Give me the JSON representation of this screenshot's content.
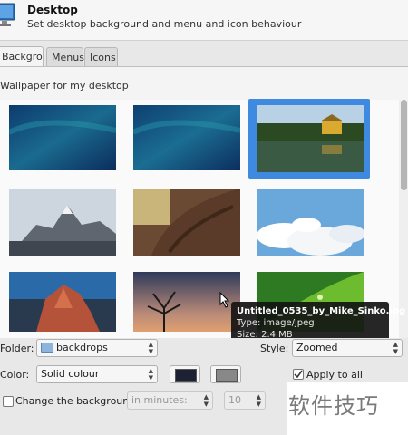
{
  "header": {
    "title": "Desktop",
    "subtitle": "Set desktop background and menu and icon behaviour",
    "icon": "monitor-icon"
  },
  "tabs": [
    {
      "label": "Background",
      "active": true
    },
    {
      "label": "Menus",
      "active": false
    },
    {
      "label": "Icons",
      "active": false
    }
  ],
  "wallpaper_section": {
    "label": "Wallpaper for my desktop",
    "thumbnails": [
      {
        "name": "blue-gradient-1",
        "selected": false
      },
      {
        "name": "blue-gradient-2",
        "selected": false
      },
      {
        "name": "Untitled_0535_by_Mike_Sinko.jpg",
        "selected": true
      },
      {
        "name": "mountain-peak",
        "selected": false
      },
      {
        "name": "tree-bark",
        "selected": false
      },
      {
        "name": "clouds-sky",
        "selected": false
      },
      {
        "name": "red-rocks-sunset",
        "selected": false
      },
      {
        "name": "tree-silhouette-dusk",
        "selected": false
      },
      {
        "name": "green-leaf-drops",
        "selected": false
      }
    ]
  },
  "tooltip": {
    "name": "Untitled_0535_by_Mike_Sinko.jpg",
    "type": "Type: image/jpeg",
    "size": "Size: 2.4 MB"
  },
  "controls": {
    "folder_label": "Folder:",
    "folder_value": "backdrops",
    "style_label": "Style:",
    "style_value": "Zoomed",
    "color_label": "Color:",
    "color_value": "Solid colour",
    "color1": "#1c2233",
    "color2": "#888888",
    "apply_all_label": "Apply to all workspaces",
    "apply_all_checked": true,
    "change_bg_label": "Change the background",
    "change_bg_checked": false,
    "interval_unit": "in minutes:",
    "interval_value": "10"
  },
  "watermark": "软件技巧"
}
